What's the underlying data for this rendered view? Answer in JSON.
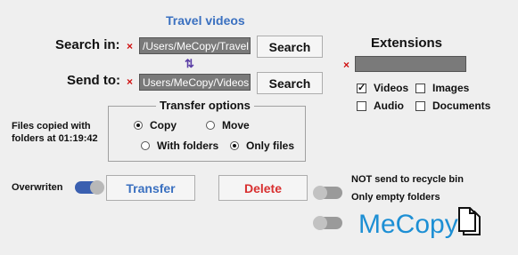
{
  "header": {
    "title": "Travel videos"
  },
  "search": {
    "label": "Search in:",
    "path": "/Users/MeCopy/Travel",
    "button": "Search"
  },
  "send": {
    "label": "Send to:",
    "path": "Users/MeCopy/Videos",
    "button": "Search"
  },
  "swap_icon": "⇅",
  "clear_icon": "×",
  "status": {
    "line1": "Files copied with",
    "line2": "folders at 01:19:42"
  },
  "transfer_options": {
    "title": "Transfer options",
    "copy": "Copy",
    "move": "Move",
    "with_folders": "With folders",
    "only_files": "Only files"
  },
  "extensions": {
    "title": "Extensions",
    "value": "",
    "videos": "Videos",
    "images": "Images",
    "audio": "Audio",
    "documents": "Documents",
    "checked": {
      "videos": true,
      "images": false,
      "audio": false,
      "documents": false
    }
  },
  "overwriten": {
    "label": "Overwriten",
    "on": true
  },
  "actions": {
    "transfer": "Transfer",
    "delete": "Delete"
  },
  "toggles": {
    "recycle": {
      "label": "NOT send to recycle bin",
      "on": false
    },
    "empty_folders": {
      "label": "Only empty folders",
      "on": false
    }
  },
  "brand": {
    "name": "MeCopy"
  },
  "colors": {
    "accent": "#3a70c0",
    "danger": "#d83030",
    "toggle_on": "#3a5fb0",
    "toggle_off": "#9a9a9a",
    "logo": "#1d8fd4"
  }
}
